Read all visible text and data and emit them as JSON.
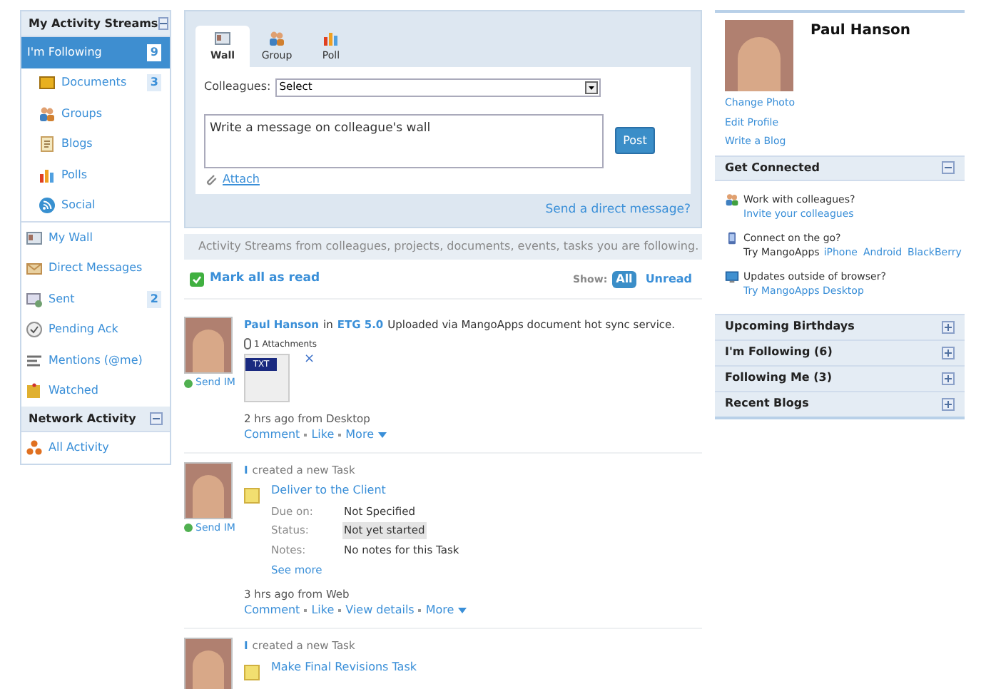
{
  "sidebar": {
    "sections": [
      {
        "title": "My Activity Streams",
        "expanded": true,
        "items": [
          {
            "label": "I'm Following",
            "count": "9",
            "kind": "minus",
            "selected": true,
            "children": [
              {
                "label": "Documents",
                "count": "3",
                "kind": "folder",
                "selected": false
              },
              {
                "label": "Groups",
                "kind": "people",
                "selected": false
              },
              {
                "label": "Blogs",
                "kind": "blog",
                "selected": false
              },
              {
                "label": "Polls",
                "kind": "poll",
                "selected": false
              },
              {
                "label": "Social",
                "kind": "social",
                "selected": false
              }
            ]
          },
          {
            "label": "My Wall",
            "kind": "wall",
            "selected": false
          },
          {
            "label": "Direct Messages",
            "kind": "message",
            "selected": false
          },
          {
            "label": "Sent",
            "count": "2",
            "kind": "sent",
            "selected": false
          },
          {
            "label": "Pending Ack",
            "kind": "ack",
            "selected": false
          },
          {
            "label": "Mentions (@me)",
            "kind": "mention",
            "selected": false
          },
          {
            "label": "Watched",
            "kind": "watch",
            "selected": false
          }
        ]
      },
      {
        "title": "Network Activity",
        "expanded": true,
        "items": [
          {
            "label": "All Activity",
            "kind": "network",
            "selected": false
          }
        ]
      }
    ]
  },
  "composer": {
    "tabs": [
      {
        "label": "Wall",
        "kind": "wall",
        "selected": true
      },
      {
        "label": "Group",
        "kind": "people",
        "selected": false
      },
      {
        "label": "Poll",
        "kind": "poll",
        "selected": false
      }
    ],
    "colleagues_label": "Colleagues:",
    "colleagues_value": "Select",
    "message_placeholder": "Write a message on colleague's wall",
    "post_button": "Post",
    "attach_link": "Attach",
    "direct_message_link": "Send a direct message?"
  },
  "info_bar": "Activity Streams from colleagues, projects, documents, events, tasks you are following.",
  "toolbar": {
    "mark_all": "Mark all as read",
    "show_label": "Show:",
    "filters": [
      {
        "label": "All",
        "selected": true
      },
      {
        "label": "Unread",
        "selected": false
      }
    ]
  },
  "feed": [
    {
      "kind": "upload",
      "send_im": "Send IM",
      "author": "Paul Hanson",
      "in": "in",
      "project": "ETG 5.0",
      "message": "Uploaded via MangoApps document hot sync service.",
      "attachments": "1 Attachments",
      "file_type": "TXT",
      "remove": "×",
      "time": "2 hrs ago from Desktop",
      "actions": [
        "Comment",
        "Like",
        "More"
      ]
    },
    {
      "kind": "task",
      "send_im": "Send IM",
      "author": "I",
      "verb": "created a new Task",
      "task": "Deliver to the Client",
      "fields": [
        {
          "label": "Due on:",
          "value": "Not Specified",
          "highlight": false
        },
        {
          "label": "Status:",
          "value": "Not yet started",
          "highlight": true
        },
        {
          "label": "Notes:",
          "value": "No notes for this Task",
          "highlight": false
        }
      ],
      "see_more": "See more",
      "time": "3 hrs ago from Web",
      "actions": [
        "Comment",
        "Like",
        "View details",
        "More"
      ]
    },
    {
      "kind": "task",
      "author": "I",
      "verb": "created a new Task",
      "task": "Make Final Revisions Task"
    }
  ],
  "profile": {
    "name": "Paul Hanson",
    "links": [
      "Change Photo",
      "Edit Profile",
      "Write a Blog"
    ]
  },
  "get_connected": {
    "title": "Get Connected",
    "expanded": true,
    "entries": [
      {
        "kind": "invite",
        "text": "Work with colleagues?",
        "links": [
          "Invite your colleagues"
        ]
      },
      {
        "kind": "phone",
        "text": "Connect on the go?",
        "prefix": "Try MangoApps",
        "links": [
          "iPhone",
          "Android",
          "BlackBerry"
        ]
      },
      {
        "kind": "desktop",
        "text": "Updates outside of browser?",
        "links": [
          "Try MangoApps Desktop"
        ]
      }
    ]
  },
  "panels": [
    {
      "title": "Upcoming Birthdays",
      "expanded": false
    },
    {
      "title": "I'm Following (6)",
      "expanded": false
    },
    {
      "title": "Following Me (3)",
      "expanded": false
    },
    {
      "title": "Recent Blogs",
      "expanded": false
    }
  ]
}
